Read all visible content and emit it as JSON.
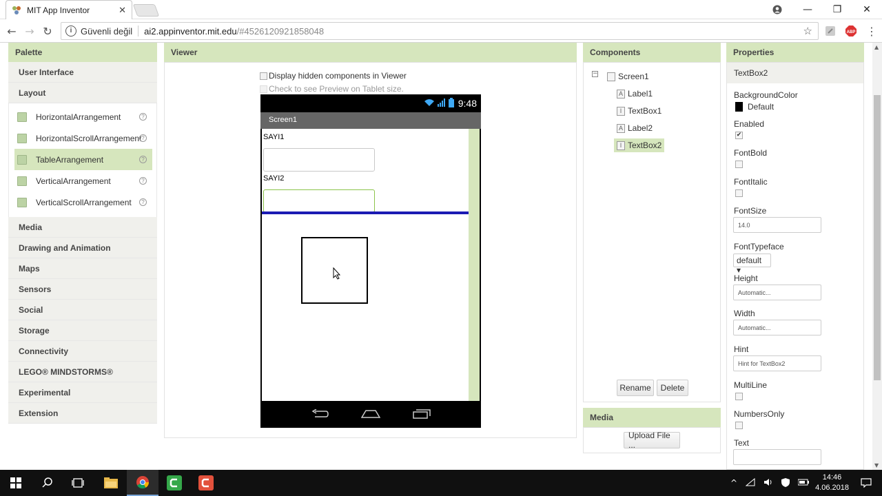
{
  "browser": {
    "tab_title": "MIT App Inventor",
    "security_label": "Güvenli değil",
    "url_host": "ai2.appinventor.mit.edu",
    "url_path": "/#4526120921858048"
  },
  "palette": {
    "title": "Palette",
    "categories_top": [
      "User Interface",
      "Layout"
    ],
    "layout_items": [
      {
        "label": "HorizontalArrangement",
        "selected": false
      },
      {
        "label": "HorizontalScrollArrangement",
        "selected": false
      },
      {
        "label": "TableArrangement",
        "selected": true
      },
      {
        "label": "VerticalArrangement",
        "selected": false
      },
      {
        "label": "VerticalScrollArrangement",
        "selected": false
      }
    ],
    "categories_bottom": [
      "Media",
      "Drawing and Animation",
      "Maps",
      "Sensors",
      "Social",
      "Storage",
      "Connectivity",
      "LEGO® MINDSTORMS®",
      "Experimental",
      "Extension"
    ],
    "help_glyph": "?"
  },
  "viewer": {
    "title": "Viewer",
    "display_hidden": "Display hidden components in Viewer",
    "tablet_preview": "Check to see Preview on Tablet size.",
    "status_time": "9:48",
    "screen_title": "Screen1",
    "label1": "SAYI1",
    "label2": "SAYI2"
  },
  "components": {
    "title": "Components",
    "tree": [
      {
        "label": "Screen1",
        "icon": "screen-icon"
      },
      {
        "label": "Label1",
        "icon": "label-icon"
      },
      {
        "label": "TextBox1",
        "icon": "textbox-icon"
      },
      {
        "label": "Label2",
        "icon": "label-icon"
      },
      {
        "label": "TextBox2",
        "icon": "textbox-icon",
        "selected": true
      }
    ],
    "rename": "Rename",
    "delete": "Delete"
  },
  "media": {
    "title": "Media",
    "upload": "Upload File ..."
  },
  "properties": {
    "title": "Properties",
    "component": "TextBox2",
    "background_color_label": "BackgroundColor",
    "background_color_value": "Default",
    "enabled_label": "Enabled",
    "enabled": true,
    "fontbold_label": "FontBold",
    "fontitalic_label": "FontItalic",
    "fontsize_label": "FontSize",
    "fontsize_value": "14.0",
    "fonttypeface_label": "FontTypeface",
    "fonttypeface_value": "default ▾",
    "height_label": "Height",
    "height_value": "Automatic...",
    "width_label": "Width",
    "width_value": "Automatic...",
    "hint_label": "Hint",
    "hint_value": "Hint for TextBox2",
    "multiline_label": "MultiLine",
    "numbersonly_label": "NumbersOnly",
    "text_label": "Text",
    "text_value": ""
  },
  "taskbar": {
    "time": "14:46",
    "date": "4.06.2018"
  },
  "colors": {
    "panel_header": "#d6e6bd",
    "selection": "#d6e6bd",
    "accent_blue": "#1b1bb3"
  }
}
